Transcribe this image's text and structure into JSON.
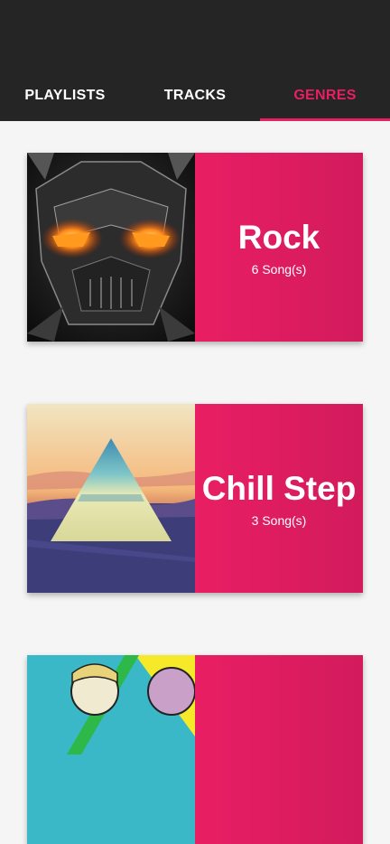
{
  "header": {
    "logo_icon": "audio-waveform-icon",
    "accent_color": "#e91e63",
    "background_color": "#252525"
  },
  "tabs": [
    {
      "label": "PLAYLISTS",
      "active": false
    },
    {
      "label": "TRACKS",
      "active": false
    },
    {
      "label": "GENRES",
      "active": true
    }
  ],
  "genres": [
    {
      "name": "Rock",
      "count": "6 Song(s)",
      "art_icon": "robot-warrior-artwork"
    },
    {
      "name": "Chill Step",
      "count": "3 Song(s)",
      "art_icon": "triangle-landscape-artwork"
    },
    {
      "name": "",
      "count": "",
      "art_icon": "pop-art-portrait-artwork"
    }
  ]
}
